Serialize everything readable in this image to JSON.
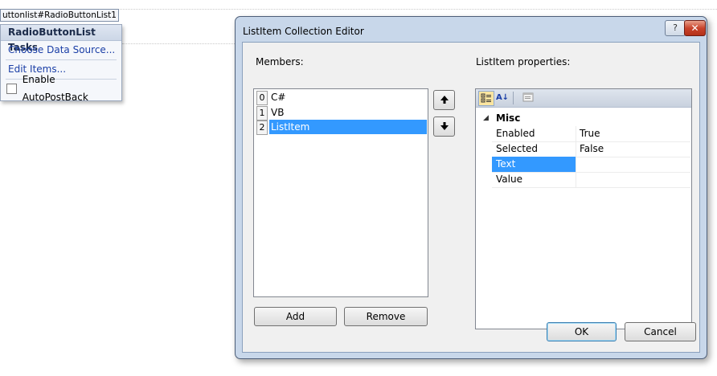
{
  "designer": {
    "control_tag": "uttonlist#RadioButtonList1",
    "tasks": {
      "title": "RadioButtonList Tasks",
      "choose_data_source": "Choose Data Source...",
      "edit_items": "Edit Items...",
      "enable_autopostback": "Enable AutoPostBack",
      "autopostback_checked": false
    }
  },
  "dialog": {
    "title": "ListItem Collection Editor",
    "help_label": "?",
    "close_label": "✕",
    "members_label": "Members:",
    "members": [
      {
        "index": "0",
        "text": "C#",
        "selected": false
      },
      {
        "index": "1",
        "text": "VB",
        "selected": false
      },
      {
        "index": "2",
        "text": "ListItem",
        "selected": true
      }
    ],
    "move_up_icon": "arrow-up-icon",
    "move_down_icon": "arrow-down-icon",
    "add_label": "Add",
    "remove_label": "Remove",
    "properties_label": "ListItem properties:",
    "property_grid": {
      "toolbar_icons": [
        "categorized-icon",
        "alphabetical-icon",
        "property-pages-icon"
      ],
      "alpha_icon_text": "A↓",
      "category": "Misc",
      "properties": [
        {
          "name": "Enabled",
          "value": "True",
          "selected": false
        },
        {
          "name": "Selected",
          "value": "False",
          "selected": false
        },
        {
          "name": "Text",
          "value": "",
          "selected": true
        },
        {
          "name": "Value",
          "value": "",
          "selected": false
        }
      ]
    },
    "ok_label": "OK",
    "cancel_label": "Cancel"
  },
  "colors": {
    "selection": "#3399ff",
    "dialog_frame": "#c8d7ea",
    "link": "#1a3ea6",
    "close_button": "#c9442c"
  }
}
